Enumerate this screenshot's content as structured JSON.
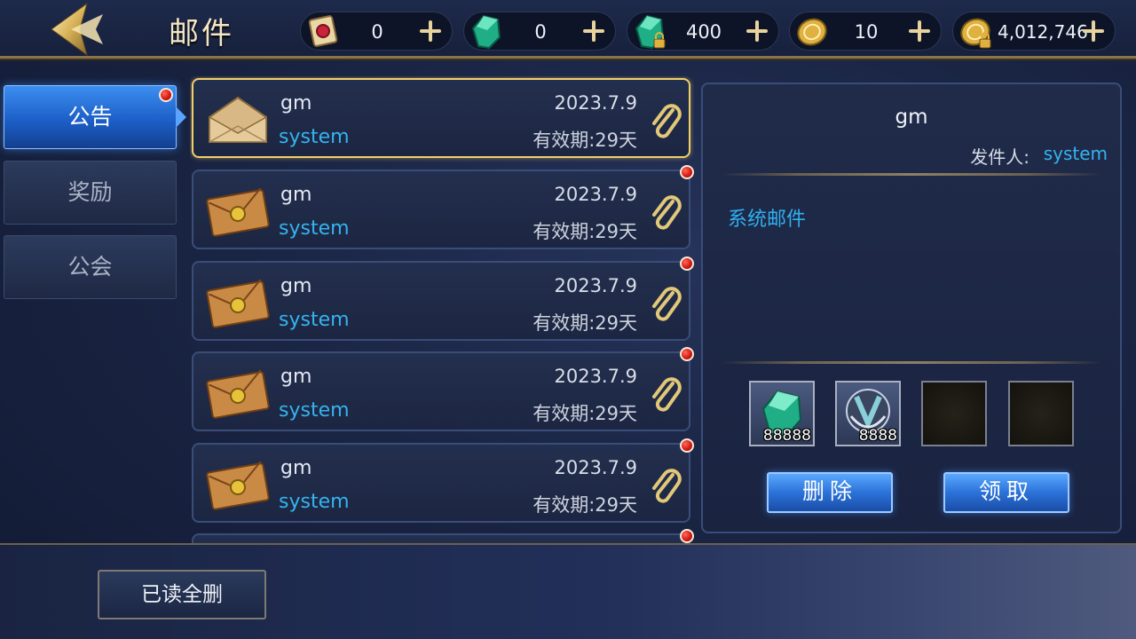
{
  "header": {
    "title": "邮件"
  },
  "currencies": [
    {
      "name": "scroll-ticket",
      "value": "0",
      "color": "#c8243a"
    },
    {
      "name": "diamond",
      "value": "0",
      "color": "#2fd0a0"
    },
    {
      "name": "bound-diamond",
      "value": "400",
      "color": "#2fd0a0"
    },
    {
      "name": "gold-coin",
      "value": "10",
      "color": "#e0b040"
    },
    {
      "name": "bound-gold-coin",
      "value": "4,012,746",
      "color": "#e0b040"
    }
  ],
  "tabs": [
    {
      "label": "公告",
      "active": true,
      "has_dot": true
    },
    {
      "label": "奖励",
      "active": false,
      "has_dot": false
    },
    {
      "label": "公会",
      "active": false,
      "has_dot": false
    }
  ],
  "mails": [
    {
      "title": "gm",
      "from": "system",
      "date": "2023.7.9",
      "expire": "有效期:29天",
      "read": true,
      "selected": true
    },
    {
      "title": "gm",
      "from": "system",
      "date": "2023.7.9",
      "expire": "有效期:29天",
      "read": false,
      "selected": false
    },
    {
      "title": "gm",
      "from": "system",
      "date": "2023.7.9",
      "expire": "有效期:29天",
      "read": false,
      "selected": false
    },
    {
      "title": "gm",
      "from": "system",
      "date": "2023.7.9",
      "expire": "有效期:29天",
      "read": false,
      "selected": false
    },
    {
      "title": "gm",
      "from": "system",
      "date": "2023.7.9",
      "expire": "有效期:29天",
      "read": false,
      "selected": false
    }
  ],
  "detail": {
    "title": "gm",
    "sender_label": "发件人:",
    "sender": "system",
    "body": "系统邮件",
    "attachments": [
      {
        "icon": "diamond-icon",
        "qty": "88888"
      },
      {
        "icon": "emblem-icon",
        "qty": "8888"
      },
      {
        "icon": "empty-slot",
        "qty": ""
      },
      {
        "icon": "empty-slot",
        "qty": ""
      }
    ],
    "delete_label": "删除",
    "claim_label": "领取"
  },
  "footer": {
    "read_delete_label": "已读全删"
  },
  "theme": {
    "accent_blue": "#2b72d8",
    "gold_border": "#f0cf6a",
    "link_cyan": "#35b3ef",
    "unread_dot": "#d0150e"
  }
}
